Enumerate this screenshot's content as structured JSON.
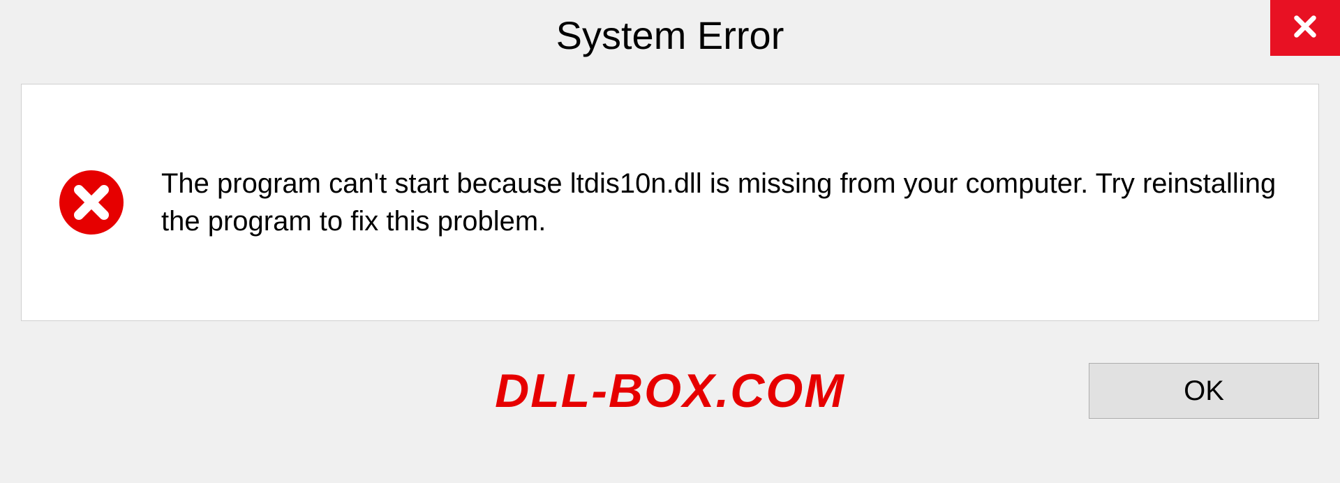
{
  "dialog": {
    "title": "System Error",
    "message": "The program can't start because ltdis10n.dll is missing from your computer. Try reinstalling the program to fix this problem.",
    "ok_label": "OK"
  },
  "watermark": "DLL-BOX.COM",
  "colors": {
    "close_bg": "#e81123",
    "error_red": "#e60000",
    "watermark_red": "#e60000"
  }
}
